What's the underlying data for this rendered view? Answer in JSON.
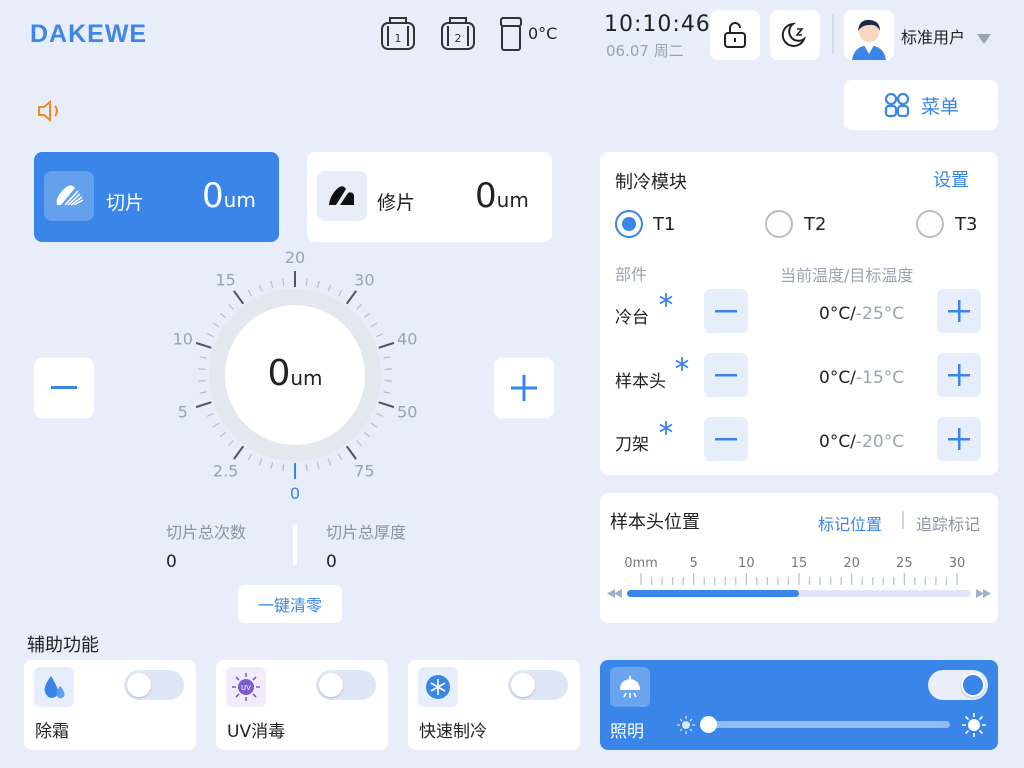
{
  "header": {
    "logo": "DAKEWE",
    "module1": "1",
    "module2": "2",
    "bin_temp": "0°C",
    "time": "10:10:46",
    "date": "06.07 周二",
    "user_name": "标准用户"
  },
  "menu_label": "菜单",
  "section_tabs": {
    "cut": {
      "label": "切片",
      "value": "0",
      "unit": "um"
    },
    "trim": {
      "label": "修片",
      "value": "0",
      "unit": "um"
    }
  },
  "dial": {
    "value": "0",
    "unit": "um",
    "ticks": [
      "0",
      "2.5",
      "5",
      "10",
      "15",
      "20",
      "30",
      "40",
      "50",
      "75"
    ]
  },
  "counters": {
    "count_label": "切片总次数",
    "count_value": "0",
    "thickness_label": "切片总厚度",
    "thickness_value": "0",
    "reset_label": "一键清零"
  },
  "cooling": {
    "title": "制冷模块",
    "settings": "设置",
    "radios": [
      {
        "label": "T1",
        "selected": true
      },
      {
        "label": "T2",
        "selected": false
      },
      {
        "label": "T3",
        "selected": false
      }
    ],
    "col_part": "部件",
    "col_temp": "当前温度/目标温度",
    "rows": [
      {
        "name": "冷台",
        "current": "0°C/",
        "target": "-25°C"
      },
      {
        "name": "样本头",
        "current": "0°C/",
        "target": "-15°C"
      },
      {
        "name": "刀架",
        "current": "0°C/",
        "target": "-20°C"
      }
    ]
  },
  "position": {
    "title": "样本头位置",
    "mark": "标记位置",
    "track": "追踪标记",
    "scale": [
      "0mm",
      "5",
      "10",
      "15",
      "20",
      "25",
      "30"
    ],
    "progress_mm": 15,
    "max_mm": 30
  },
  "aux": {
    "title": "辅助功能",
    "items": [
      {
        "label": "除霜",
        "on": false
      },
      {
        "label": "UV消毒",
        "on": false,
        "icon_text": "UV"
      },
      {
        "label": "快速制冷",
        "on": false
      }
    ],
    "light": {
      "label": "照明",
      "on": true,
      "level": 0
    }
  },
  "colors": {
    "accent": "#3a86e8",
    "background": "#e8eef9"
  }
}
